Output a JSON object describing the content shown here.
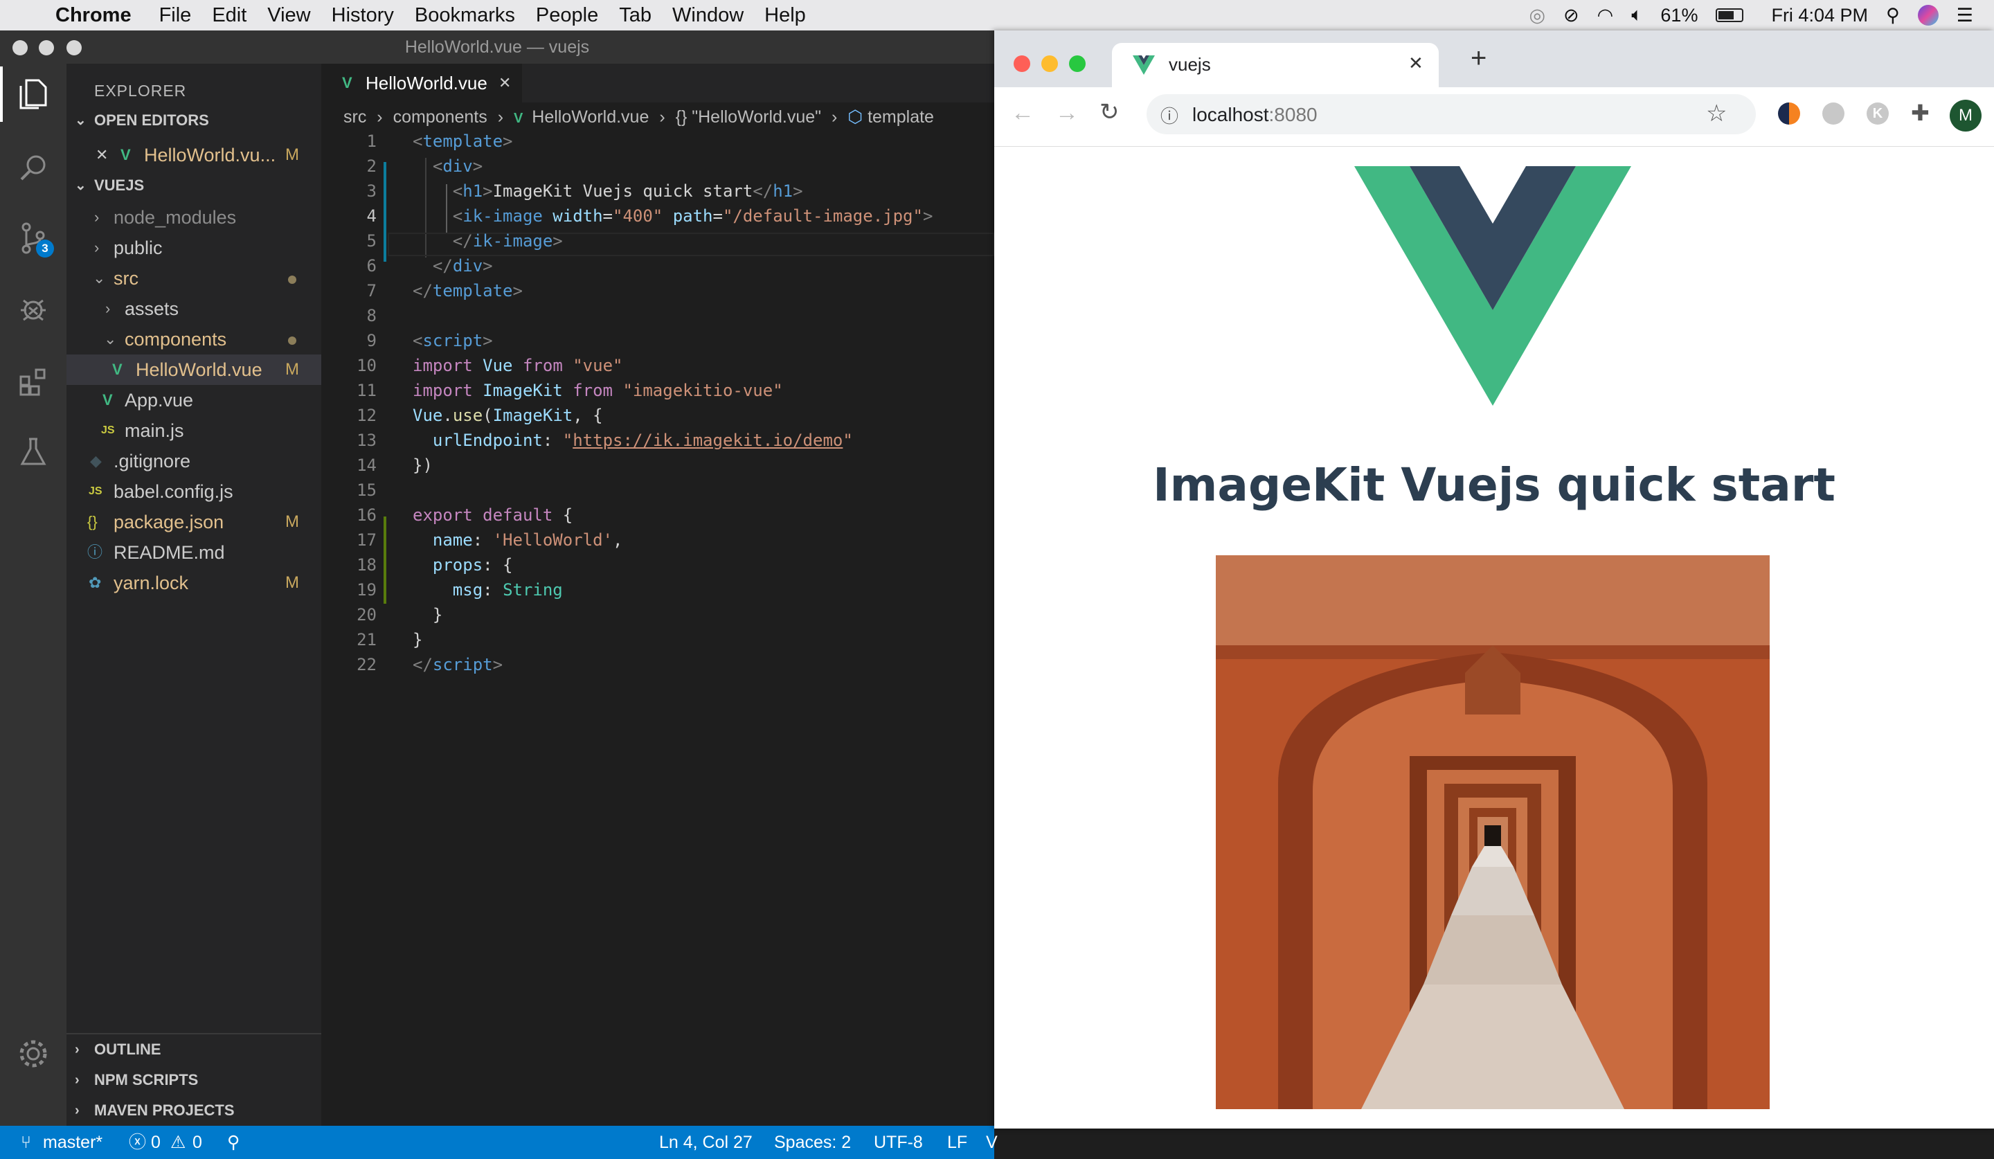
{
  "menubar": {
    "app": "Chrome",
    "items": [
      "File",
      "Edit",
      "View",
      "History",
      "Bookmarks",
      "People",
      "Tab",
      "Window",
      "Help"
    ],
    "battery": "61%",
    "clock": "Fri 4:04 PM"
  },
  "vscode": {
    "window_title": "HelloWorld.vue — vuejs",
    "scm_badge": "3",
    "explorer_title": "EXPLORER",
    "open_editors_label": "OPEN EDITORS",
    "open_editor_file": "HelloWorld.vu...",
    "open_editor_badge": "M",
    "folder_label": "VUEJS",
    "tree": [
      {
        "name": "node_modules",
        "badge": ""
      },
      {
        "name": "public",
        "badge": ""
      },
      {
        "name": "src",
        "badge": ""
      },
      {
        "name": "assets",
        "badge": ""
      },
      {
        "name": "components",
        "badge": ""
      },
      {
        "name": "HelloWorld.vue",
        "badge": "M"
      },
      {
        "name": "App.vue",
        "badge": ""
      },
      {
        "name": "main.js",
        "badge": ""
      },
      {
        "name": ".gitignore",
        "badge": ""
      },
      {
        "name": "babel.config.js",
        "badge": ""
      },
      {
        "name": "package.json",
        "badge": "M"
      },
      {
        "name": "README.md",
        "badge": ""
      },
      {
        "name": "yarn.lock",
        "badge": "M"
      }
    ],
    "outline_label": "OUTLINE",
    "npm_label": "NPM SCRIPTS",
    "maven_label": "MAVEN PROJECTS",
    "tab_label": "HelloWorld.vue",
    "breadcrumb": [
      "src",
      "components",
      "HelloWorld.vue",
      "{} \"HelloWorld.vue\"",
      "template"
    ],
    "line_numbers": [
      "1",
      "2",
      "3",
      "4",
      "5",
      "6",
      "7",
      "8",
      "9",
      "10",
      "11",
      "12",
      "13",
      "14",
      "15",
      "16",
      "17",
      "18",
      "19",
      "20",
      "21",
      "22"
    ],
    "status": {
      "branch": "master*",
      "errors": "0",
      "warnings": "0",
      "position": "Ln 4, Col 27",
      "spaces": "Spaces: 2",
      "encoding": "UTF-8",
      "eol": "LF",
      "lang": "V"
    }
  },
  "chrome": {
    "tab_title": "vuejs",
    "url_host": "localhost",
    "url_port": ":8080",
    "profile_initial": "M",
    "page_heading": "ImageKit Vuejs quick start"
  },
  "colors": {
    "vue_green": "#41b883",
    "vue_dark": "#35495e",
    "vscode_blue": "#007acc"
  }
}
